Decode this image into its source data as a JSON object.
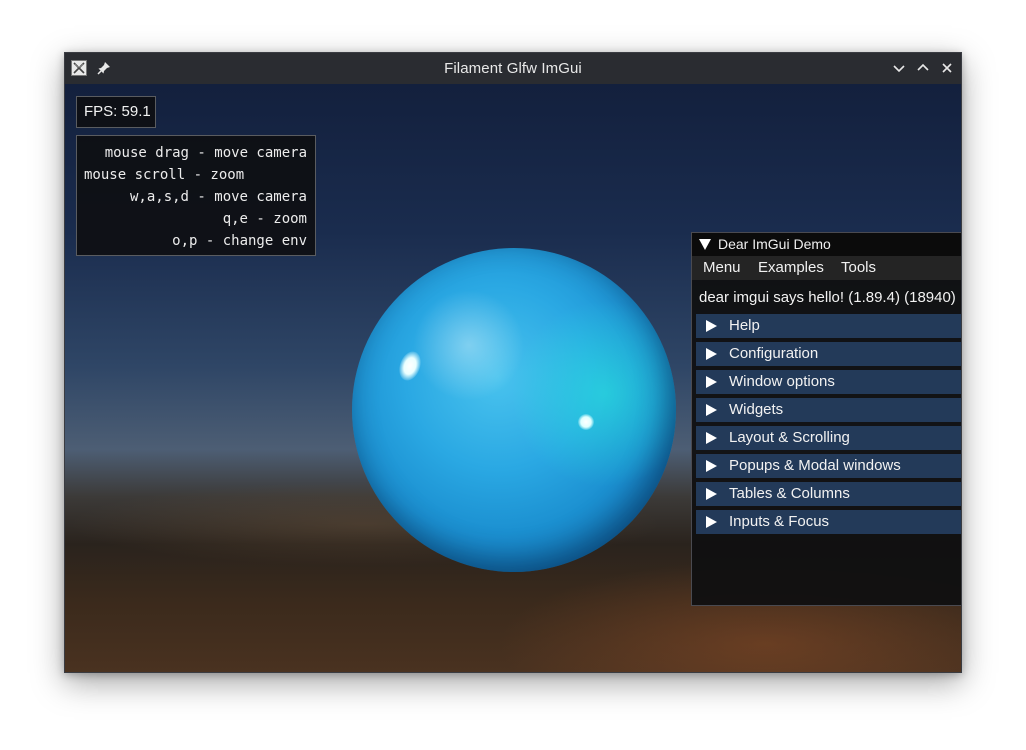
{
  "window": {
    "title": "Filament Glfw ImGui",
    "icons": {
      "app": "app-icon",
      "pin": "pin-icon",
      "minimize": "chevron-down-icon",
      "maximize": "chevron-up-icon",
      "close": "close-icon"
    }
  },
  "viewport": {
    "fps_label": "FPS: 59.1",
    "help_lines": [
      "mouse drag - move camera",
      "mouse scroll - zoom",
      "w,a,s,d - move camera",
      "q,e - zoom",
      "o,p - change env"
    ]
  },
  "imgui": {
    "title": "Dear ImGui Demo",
    "menu": [
      "Menu",
      "Examples",
      "Tools"
    ],
    "hello": "dear imgui says hello! (1.89.4) (18940)",
    "headers": [
      "Help",
      "Configuration",
      "Window options",
      "Widgets",
      "Layout & Scrolling",
      "Popups & Modal windows",
      "Tables & Columns",
      "Inputs & Focus"
    ]
  },
  "colors": {
    "titlebar": "#2a2c31",
    "header_bg": "#233a59",
    "sphere": "#2aa8e3"
  }
}
